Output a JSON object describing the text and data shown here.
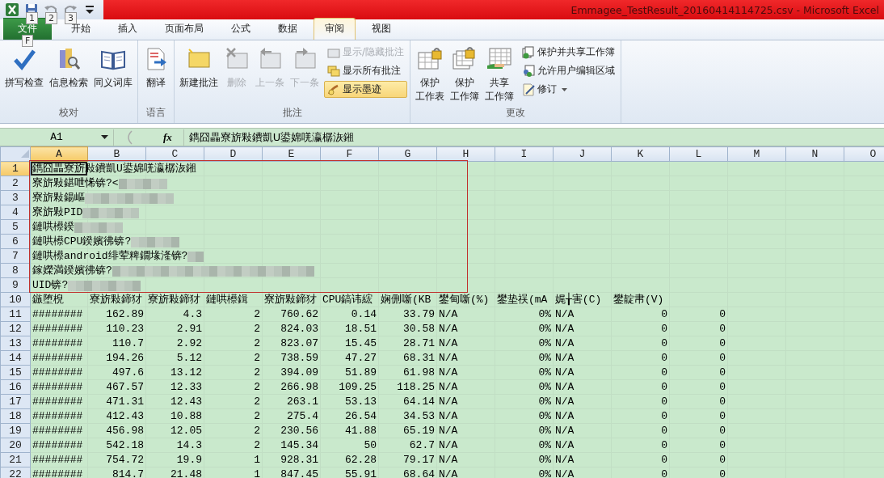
{
  "window": {
    "title": "Emmagee_TestResult_20160414114725.csv  -  Microsoft Excel"
  },
  "quick_access": [
    {
      "disabled": false
    },
    {
      "keytip": "1",
      "disabled": false
    },
    {
      "keytip": "2",
      "disabled": true
    },
    {
      "keytip": "3",
      "disabled": true
    },
    {
      "disabled": false
    }
  ],
  "tabs": [
    {
      "label": "文件",
      "kind": "file",
      "keytip": "F",
      "selected": false
    },
    {
      "label": "开始",
      "kind": "tab",
      "selected": false
    },
    {
      "label": "插入",
      "kind": "tab",
      "selected": false
    },
    {
      "label": "页面布局",
      "kind": "tab",
      "selected": false
    },
    {
      "label": "公式",
      "kind": "tab",
      "selected": false
    },
    {
      "label": "数据",
      "kind": "tab",
      "selected": false
    },
    {
      "label": "审阅",
      "kind": "tab",
      "selected": true
    },
    {
      "label": "视图",
      "kind": "tab",
      "selected": false
    }
  ],
  "ribbon_groups": [
    {
      "label": "校对",
      "items": [
        {
          "kind": "large",
          "lines": [
            "拼写检查"
          ],
          "disabled": false
        },
        {
          "kind": "large",
          "lines": [
            "信息检索"
          ],
          "disabled": false
        },
        {
          "kind": "large",
          "lines": [
            "同义词库"
          ],
          "disabled": false
        }
      ]
    },
    {
      "label": "语言",
      "items": [
        {
          "kind": "large",
          "lines": [
            "翻译"
          ],
          "disabled": false
        }
      ]
    },
    {
      "label": "批注",
      "items": [
        {
          "kind": "large",
          "lines": [
            "新建批注"
          ],
          "disabled": false
        },
        {
          "kind": "large",
          "lines": [
            "删除"
          ],
          "disabled": true
        },
        {
          "kind": "large",
          "lines": [
            "上一条"
          ],
          "disabled": true
        },
        {
          "kind": "large",
          "lines": [
            "下一条"
          ],
          "disabled": true
        },
        {
          "kind": "small",
          "lines": [
            "显示/隐藏批注"
          ],
          "disabled": true,
          "active": false
        },
        {
          "kind": "small",
          "lines": [
            "显示所有批注"
          ],
          "disabled": false,
          "active": false
        },
        {
          "kind": "small",
          "lines": [
            "显示墨迹"
          ],
          "disabled": false,
          "active": true
        }
      ]
    },
    {
      "label": "更改",
      "items": [
        {
          "kind": "large",
          "lines": [
            "保护",
            "工作表"
          ],
          "disabled": false
        },
        {
          "kind": "large",
          "lines": [
            "保护",
            "工作簿"
          ],
          "disabled": false
        },
        {
          "kind": "large",
          "lines": [
            "共享",
            "工作簿"
          ],
          "disabled": false
        },
        {
          "kind": "small",
          "lines": [
            "保护并共享工作簿"
          ],
          "disabled": false,
          "active": false
        },
        {
          "kind": "small",
          "lines": [
            "允许用户编辑区域"
          ],
          "disabled": false,
          "active": false
        },
        {
          "kind": "small",
          "lines": [
            "修订"
          ],
          "disabled": false,
          "active": false,
          "dropdown": true
        }
      ]
    }
  ],
  "formula_bar": {
    "name_box": "A1",
    "function_label": "fx",
    "value": "鐫囧畾寮旂敤鐨凱U鍙婂唴瀛樼洃鎺"
  },
  "highlight_frame": true,
  "columns": [
    {
      "label": "A",
      "selected": true
    },
    {
      "label": "B",
      "selected": false
    },
    {
      "label": "C",
      "selected": false
    },
    {
      "label": "D",
      "selected": false
    },
    {
      "label": "E",
      "selected": false
    },
    {
      "label": "F",
      "selected": false
    },
    {
      "label": "G",
      "selected": false
    },
    {
      "label": "H",
      "selected": false
    },
    {
      "label": "I",
      "selected": false
    },
    {
      "label": "J",
      "selected": false
    },
    {
      "label": "K",
      "selected": false
    },
    {
      "label": "L",
      "selected": false
    },
    {
      "label": "M",
      "selected": false
    },
    {
      "label": "N",
      "selected": false
    },
    {
      "label": "O",
      "selected": false
    }
  ],
  "rows": [
    {
      "number": "1",
      "selected": true,
      "cells": [
        {
          "text": "鐫囧畾寮旂敤鐨凱U鍙婂唴瀛樼洃鎺",
          "kind": "text"
        }
      ]
    },
    {
      "number": "2",
      "selected": false,
      "cells": [
        {
          "text": "寮旂敤鍖呭悕锛?<",
          "kind": "text",
          "redacted": true
        }
      ]
    },
    {
      "number": "3",
      "selected": false,
      "cells": [
        {
          "text": "寮旂敤鍚嶇",
          "kind": "text",
          "redacted": true
        }
      ]
    },
    {
      "number": "4",
      "selected": false,
      "cells": [
        {
          "text": "寮旂敤PID",
          "kind": "text",
          "redacted": true
        }
      ]
    },
    {
      "number": "5",
      "selected": false,
      "cells": [
        {
          "text": "鏈哄櫒鍨",
          "kind": "text",
          "redacted": true
        }
      ]
    },
    {
      "number": "6",
      "selected": false,
      "cells": [
        {
          "text": "鏈哄櫒CPU鍨嬪彿锛?",
          "kind": "text",
          "redacted": true
        }
      ]
    },
    {
      "number": "7",
      "selected": false,
      "cells": [
        {
          "text": "鏈哄櫒android绯荤粺鐗堟湰锛?",
          "kind": "text",
          "redacted": true
        }
      ]
    },
    {
      "number": "8",
      "selected": false,
      "cells": [
        {
          "text": "鎵嬫満鍨嬪彿锛?",
          "kind": "text",
          "redacted": true
        }
      ]
    },
    {
      "number": "9",
      "selected": false,
      "cells": [
        {
          "text": "UID锛?",
          "kind": "text",
          "redacted": true
        }
      ]
    },
    {
      "number": "10",
      "selected": false,
      "cells": [
        {
          "text": "鏃堕棿",
          "kind": "text"
        },
        {
          "text": "寮旂敤鍗犲",
          "kind": "text"
        },
        {
          "text": "寮旂敤鍗犲",
          "kind": "text"
        },
        {
          "text": "鏈哄櫒鍓",
          "kind": "text"
        },
        {
          "text": "寮旂敤鍗犲",
          "kind": "text"
        },
        {
          "text": "CPU鎬讳綋",
          "kind": "text"
        },
        {
          "text": "娴侀噺(KB",
          "kind": "text"
        },
        {
          "text": "鐢甸噺(%)",
          "kind": "text"
        },
        {
          "text": "鐢垫祦(mA",
          "kind": "text"
        },
        {
          "text": "娓╁害(C)",
          "kind": "text"
        },
        {
          "text": "鐢靛帇(V)",
          "kind": "text"
        }
      ]
    },
    {
      "number": "11",
      "selected": false,
      "cells": [
        {
          "text": "########",
          "kind": "text"
        },
        {
          "text": "162.89",
          "kind": "number"
        },
        {
          "text": "4.3",
          "kind": "number"
        },
        {
          "text": "2",
          "kind": "number"
        },
        {
          "text": "760.62",
          "kind": "number"
        },
        {
          "text": "0.14",
          "kind": "number"
        },
        {
          "text": "33.79",
          "kind": "number"
        },
        {
          "text": "N/A",
          "kind": "text"
        },
        {
          "text": "0%",
          "kind": "number"
        },
        {
          "text": "N/A",
          "kind": "text"
        },
        {
          "text": "0",
          "kind": "number"
        },
        {
          "text": "0",
          "kind": "number"
        }
      ]
    },
    {
      "number": "12",
      "selected": false,
      "cells": [
        {
          "text": "########",
          "kind": "text"
        },
        {
          "text": "110.23",
          "kind": "number"
        },
        {
          "text": "2.91",
          "kind": "number"
        },
        {
          "text": "2",
          "kind": "number"
        },
        {
          "text": "824.03",
          "kind": "number"
        },
        {
          "text": "18.51",
          "kind": "number"
        },
        {
          "text": "30.58",
          "kind": "number"
        },
        {
          "text": "N/A",
          "kind": "text"
        },
        {
          "text": "0%",
          "kind": "number"
        },
        {
          "text": "N/A",
          "kind": "text"
        },
        {
          "text": "0",
          "kind": "number"
        },
        {
          "text": "0",
          "kind": "number"
        }
      ]
    },
    {
      "number": "13",
      "selected": false,
      "cells": [
        {
          "text": "########",
          "kind": "text"
        },
        {
          "text": "110.7",
          "kind": "number"
        },
        {
          "text": "2.92",
          "kind": "number"
        },
        {
          "text": "2",
          "kind": "number"
        },
        {
          "text": "823.07",
          "kind": "number"
        },
        {
          "text": "15.45",
          "kind": "number"
        },
        {
          "text": "28.71",
          "kind": "number"
        },
        {
          "text": "N/A",
          "kind": "text"
        },
        {
          "text": "0%",
          "kind": "number"
        },
        {
          "text": "N/A",
          "kind": "text"
        },
        {
          "text": "0",
          "kind": "number"
        },
        {
          "text": "0",
          "kind": "number"
        }
      ]
    },
    {
      "number": "14",
      "selected": false,
      "cells": [
        {
          "text": "########",
          "kind": "text"
        },
        {
          "text": "194.26",
          "kind": "number"
        },
        {
          "text": "5.12",
          "kind": "number"
        },
        {
          "text": "2",
          "kind": "number"
        },
        {
          "text": "738.59",
          "kind": "number"
        },
        {
          "text": "47.27",
          "kind": "number"
        },
        {
          "text": "68.31",
          "kind": "number"
        },
        {
          "text": "N/A",
          "kind": "text"
        },
        {
          "text": "0%",
          "kind": "number"
        },
        {
          "text": "N/A",
          "kind": "text"
        },
        {
          "text": "0",
          "kind": "number"
        },
        {
          "text": "0",
          "kind": "number"
        }
      ]
    },
    {
      "number": "15",
      "selected": false,
      "cells": [
        {
          "text": "########",
          "kind": "text"
        },
        {
          "text": "497.6",
          "kind": "number"
        },
        {
          "text": "13.12",
          "kind": "number"
        },
        {
          "text": "2",
          "kind": "number"
        },
        {
          "text": "394.09",
          "kind": "number"
        },
        {
          "text": "51.89",
          "kind": "number"
        },
        {
          "text": "61.98",
          "kind": "number"
        },
        {
          "text": "N/A",
          "kind": "text"
        },
        {
          "text": "0%",
          "kind": "number"
        },
        {
          "text": "N/A",
          "kind": "text"
        },
        {
          "text": "0",
          "kind": "number"
        },
        {
          "text": "0",
          "kind": "number"
        }
      ]
    },
    {
      "number": "16",
      "selected": false,
      "cells": [
        {
          "text": "########",
          "kind": "text"
        },
        {
          "text": "467.57",
          "kind": "number"
        },
        {
          "text": "12.33",
          "kind": "number"
        },
        {
          "text": "2",
          "kind": "number"
        },
        {
          "text": "266.98",
          "kind": "number"
        },
        {
          "text": "109.25",
          "kind": "number"
        },
        {
          "text": "118.25",
          "kind": "number"
        },
        {
          "text": "N/A",
          "kind": "text"
        },
        {
          "text": "0%",
          "kind": "number"
        },
        {
          "text": "N/A",
          "kind": "text"
        },
        {
          "text": "0",
          "kind": "number"
        },
        {
          "text": "0",
          "kind": "number"
        }
      ]
    },
    {
      "number": "17",
      "selected": false,
      "cells": [
        {
          "text": "########",
          "kind": "text"
        },
        {
          "text": "471.31",
          "kind": "number"
        },
        {
          "text": "12.43",
          "kind": "number"
        },
        {
          "text": "2",
          "kind": "number"
        },
        {
          "text": "263.1",
          "kind": "number"
        },
        {
          "text": "53.13",
          "kind": "number"
        },
        {
          "text": "64.14",
          "kind": "number"
        },
        {
          "text": "N/A",
          "kind": "text"
        },
        {
          "text": "0%",
          "kind": "number"
        },
        {
          "text": "N/A",
          "kind": "text"
        },
        {
          "text": "0",
          "kind": "number"
        },
        {
          "text": "0",
          "kind": "number"
        }
      ]
    },
    {
      "number": "18",
      "selected": false,
      "cells": [
        {
          "text": "########",
          "kind": "text"
        },
        {
          "text": "412.43",
          "kind": "number"
        },
        {
          "text": "10.88",
          "kind": "number"
        },
        {
          "text": "2",
          "kind": "number"
        },
        {
          "text": "275.4",
          "kind": "number"
        },
        {
          "text": "26.54",
          "kind": "number"
        },
        {
          "text": "34.53",
          "kind": "number"
        },
        {
          "text": "N/A",
          "kind": "text"
        },
        {
          "text": "0%",
          "kind": "number"
        },
        {
          "text": "N/A",
          "kind": "text"
        },
        {
          "text": "0",
          "kind": "number"
        },
        {
          "text": "0",
          "kind": "number"
        }
      ]
    },
    {
      "number": "19",
      "selected": false,
      "cells": [
        {
          "text": "########",
          "kind": "text"
        },
        {
          "text": "456.98",
          "kind": "number"
        },
        {
          "text": "12.05",
          "kind": "number"
        },
        {
          "text": "2",
          "kind": "number"
        },
        {
          "text": "230.56",
          "kind": "number"
        },
        {
          "text": "41.88",
          "kind": "number"
        },
        {
          "text": "65.19",
          "kind": "number"
        },
        {
          "text": "N/A",
          "kind": "text"
        },
        {
          "text": "0%",
          "kind": "number"
        },
        {
          "text": "N/A",
          "kind": "text"
        },
        {
          "text": "0",
          "kind": "number"
        },
        {
          "text": "0",
          "kind": "number"
        }
      ]
    },
    {
      "number": "20",
      "selected": false,
      "cells": [
        {
          "text": "########",
          "kind": "text"
        },
        {
          "text": "542.18",
          "kind": "number"
        },
        {
          "text": "14.3",
          "kind": "number"
        },
        {
          "text": "2",
          "kind": "number"
        },
        {
          "text": "145.34",
          "kind": "number"
        },
        {
          "text": "50",
          "kind": "number"
        },
        {
          "text": "62.7",
          "kind": "number"
        },
        {
          "text": "N/A",
          "kind": "text"
        },
        {
          "text": "0%",
          "kind": "number"
        },
        {
          "text": "N/A",
          "kind": "text"
        },
        {
          "text": "0",
          "kind": "number"
        },
        {
          "text": "0",
          "kind": "number"
        }
      ]
    },
    {
      "number": "21",
      "selected": false,
      "cells": [
        {
          "text": "########",
          "kind": "text"
        },
        {
          "text": "754.72",
          "kind": "number"
        },
        {
          "text": "19.9",
          "kind": "number"
        },
        {
          "text": "1",
          "kind": "number"
        },
        {
          "text": "928.31",
          "kind": "number"
        },
        {
          "text": "62.28",
          "kind": "number"
        },
        {
          "text": "79.17",
          "kind": "number"
        },
        {
          "text": "N/A",
          "kind": "text"
        },
        {
          "text": "0%",
          "kind": "number"
        },
        {
          "text": "N/A",
          "kind": "text"
        },
        {
          "text": "0",
          "kind": "number"
        },
        {
          "text": "0",
          "kind": "number"
        }
      ]
    },
    {
      "number": "22",
      "selected": false,
      "cells": [
        {
          "text": "########",
          "kind": "text"
        },
        {
          "text": "814.7",
          "kind": "number"
        },
        {
          "text": "21.48",
          "kind": "number"
        },
        {
          "text": "1",
          "kind": "number"
        },
        {
          "text": "847.45",
          "kind": "number"
        },
        {
          "text": "55.91",
          "kind": "number"
        },
        {
          "text": "68.64",
          "kind": "number"
        },
        {
          "text": "N/A",
          "kind": "text"
        },
        {
          "text": "0%",
          "kind": "number"
        },
        {
          "text": "N/A",
          "kind": "text"
        },
        {
          "text": "0",
          "kind": "number"
        },
        {
          "text": "0",
          "kind": "number"
        }
      ]
    }
  ]
}
